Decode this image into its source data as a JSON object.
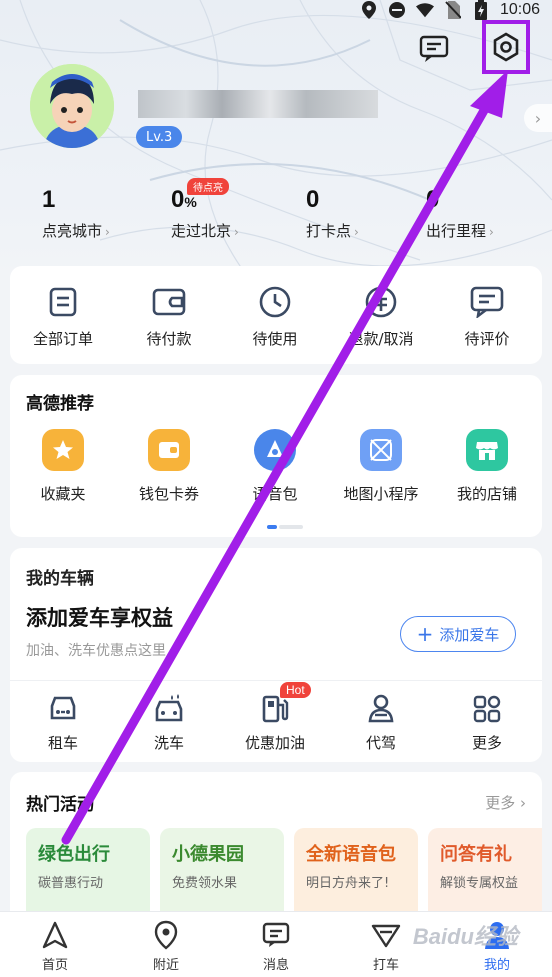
{
  "status_bar": {
    "time": "10:06"
  },
  "profile": {
    "level": "Lv.3",
    "arrow": "›"
  },
  "stats": [
    {
      "value": "1",
      "unit": "",
      "label": "点亮城市",
      "tag": ""
    },
    {
      "value": "0",
      "unit": "%",
      "label": "走过北京",
      "tag": "待点亮"
    },
    {
      "value": "0",
      "unit": "",
      "label": "打卡点",
      "tag": ""
    },
    {
      "value": "0",
      "unit": "",
      "label": "出行里程",
      "tag": ""
    }
  ],
  "orders": [
    {
      "label": "全部订单",
      "icon": "order-icon"
    },
    {
      "label": "待付款",
      "icon": "wallet-icon"
    },
    {
      "label": "待使用",
      "icon": "clock-icon"
    },
    {
      "label": "退款/取消",
      "icon": "refund-icon"
    },
    {
      "label": "待评价",
      "icon": "comment-icon"
    }
  ],
  "recommend": {
    "title": "高德推荐",
    "items": [
      {
        "label": "收藏夹",
        "icon": "star-icon",
        "color": "#f7b33a"
      },
      {
        "label": "钱包卡券",
        "icon": "wallet-card-icon",
        "color": "#f7b33a"
      },
      {
        "label": "语音包",
        "icon": "voice-pack-icon",
        "color": "#4a86ea"
      },
      {
        "label": "地图小程序",
        "icon": "mini-program-icon",
        "color": "#6fa0f5"
      },
      {
        "label": "我的店铺",
        "icon": "shop-icon",
        "color": "#2ec7a0"
      }
    ]
  },
  "vehicle": {
    "title": "我的车辆",
    "headline": "添加爱车享权益",
    "subtitle": "加油、洗车优惠点这里",
    "add_button": "添加爱车",
    "services": [
      {
        "label": "租车",
        "icon": "car-rental-icon",
        "badge": ""
      },
      {
        "label": "洗车",
        "icon": "car-wash-icon",
        "badge": ""
      },
      {
        "label": "优惠加油",
        "icon": "fuel-icon",
        "badge": "Hot"
      },
      {
        "label": "代驾",
        "icon": "driver-icon",
        "badge": ""
      },
      {
        "label": "更多",
        "icon": "more-grid-icon",
        "badge": ""
      }
    ]
  },
  "activities": {
    "title": "热门活动",
    "more": "更多",
    "tiles": [
      {
        "title": "绿色出行",
        "subtitle": "碳普惠行动",
        "bg": "#e6f6e4",
        "fg": "#2a8a3a"
      },
      {
        "title": "小德果园",
        "subtitle": "免费领水果",
        "bg": "#eaf6e6",
        "fg": "#3b8a2f"
      },
      {
        "title": "全新语音包",
        "subtitle": "明日方舟来了!",
        "bg": "#fdeede",
        "fg": "#e0621c"
      },
      {
        "title": "问答有礼",
        "subtitle": "解锁专属权益",
        "bg": "#fdeee4",
        "fg": "#e05a2b"
      }
    ]
  },
  "tabs": [
    {
      "label": "首页",
      "icon": "navigate-icon"
    },
    {
      "label": "附近",
      "icon": "location-pin-icon"
    },
    {
      "label": "消息",
      "icon": "message-icon"
    },
    {
      "label": "打车",
      "icon": "taxi-icon"
    },
    {
      "label": "我的",
      "icon": "user-icon"
    }
  ],
  "watermark": "Baidu经验",
  "colors": {
    "accent": "#2d6df0",
    "highlight": "#a11ee8",
    "hot": "#f0433b"
  }
}
